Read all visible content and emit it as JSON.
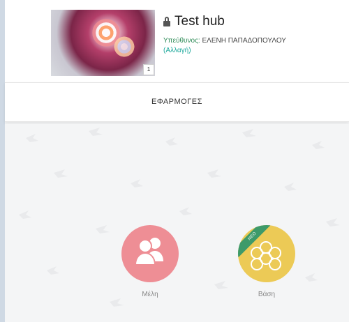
{
  "hub": {
    "title": "Test hub",
    "manager_label": "Υπεύθυνος:",
    "manager_name": "ΕΛΕΝΗ ΠΑΠΑΔΟΠΟΥΛΟΥ",
    "leave_link": "(Αλλαγή)",
    "cover_badge": "1"
  },
  "tabs": [
    {
      "label": "ΕΦΑΡΜΟΓΕΣ"
    }
  ],
  "apps": [
    {
      "name": "Μέλη",
      "icon": "users-icon",
      "color": "#ee8e95"
    },
    {
      "name": "Βάση",
      "icon": "hexagons-icon",
      "color": "#ecca56",
      "ribbon": "ΝΕΟ"
    }
  ],
  "colors": {
    "accent_link": "#1aa79a",
    "ribbon": "#3d9a6a",
    "background": "#f4f5f6"
  }
}
